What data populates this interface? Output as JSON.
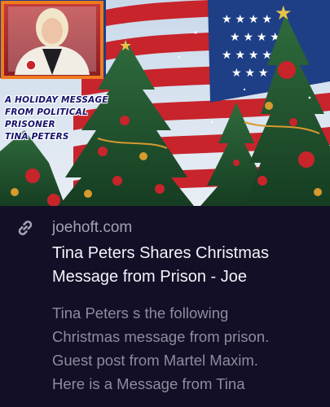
{
  "article": {
    "image_caption": [
      "A HOLIDAY MESSAGE",
      "FROM POLITICAL",
      "PRISONER",
      "TINA PETERS"
    ],
    "source_domain": "joehoft.com",
    "title_lines": [
      "Tina Peters Shares Christmas",
      "Message from Prison - Joe"
    ],
    "excerpt_lines": [
      "Tina Peters s the following",
      "Christmas message from prison.",
      "Guest post from Martel Maxim.",
      "Here is a Message from Tina"
    ]
  },
  "icons": {
    "source": "link-icon"
  },
  "colors": {
    "background": "#120f26",
    "title": "#f4f3fa",
    "domain": "#a3a2b1",
    "excerpt": "#8e8c9e",
    "frame": "#f07a1e",
    "caption": "#14126b"
  }
}
